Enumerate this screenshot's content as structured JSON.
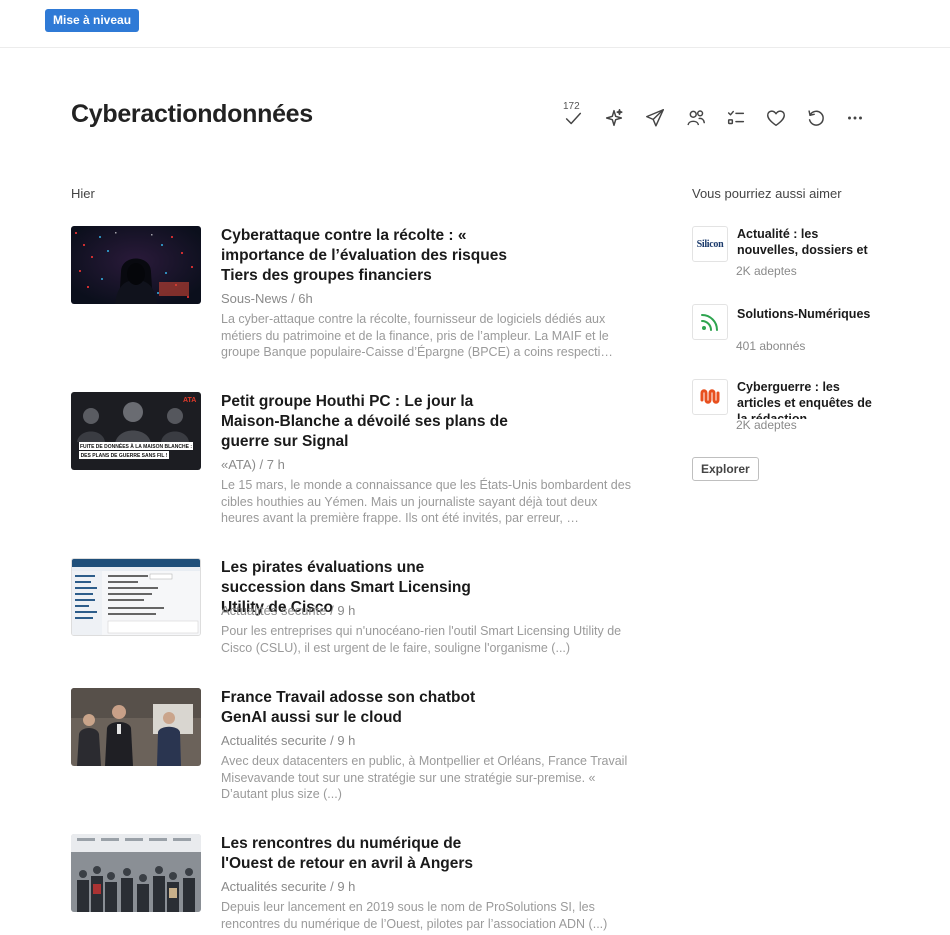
{
  "topbar": {
    "upgrade_label": "Mise à niveau"
  },
  "feed": {
    "title": "Cyberactiondonnées",
    "unread_count": "172",
    "section_label": "Hier"
  },
  "articles": [
    {
      "title": "Cyberattaque contre la récolte : « importance de l’évaluation des risques Tiers des groupes financiers",
      "meta": "Sous-News / 6h",
      "summary": "La cyber-attaque contre la récolte, fournisseur de logiciels dédiés aux métiers du patrimoine et de la finance, pris de l’ampleur. La MAIF et le groupe Banque populaire-Caisse d’Épargne (BPCE) a coins respecti…"
    },
    {
      "title": "Petit groupe Houthi PC : Le jour la Maison-Blanche a dévoilé ses plans de guerre sur Signal",
      "meta": "«ATA) / 7 h",
      "summary": "Le 15 mars, le monde a connaissance que les États-Unis bombardent des cibles houthies au Yémen. Mais un journaliste sayant déjà tout deux heures avant la première frappe. Ils ont été invités, par erreur, …",
      "thumb_caption_1": "FUITE DE DONNÉES À LA MAISON BLANCHE :",
      "thumb_caption_2": "DES PLANS DE GUERRE SANS FIL !"
    },
    {
      "title": "Les pirates évaluations une succession dans Smart Licensing Utility de Cisco",
      "meta": "Actualités securite / 9 h",
      "summary": "Pour les entreprises qui n'unocéano-rien l'outil Smart Licensing Utility de Cisco (CSLU), il est urgent de le faire, souligne l'organisme (...)"
    },
    {
      "title": "France Travail adosse son chatbot GenAI aussi sur le cloud",
      "meta": "Actualités securite / 9 h",
      "summary": "Avec deux datacenters en public, à Montpellier et Orléans, France Travail Misevavande tout sur une stratégie sur une stratégie sur-premise. « D’autant plus size (...)"
    },
    {
      "title": "Les rencontres du numérique de l'Ouest de retour en avril à Angers",
      "meta": "Actualités securite / 9 h",
      "summary": "Depuis leur lancement en 2019 sous le nom de ProSolutions SI, les rencontres du numérique de l’Ouest, pilotes par l’association ADN (...)"
    }
  ],
  "sidebar": {
    "title": "Vous pourriez aussi aimer",
    "items": [
      {
        "name": "Actualité : les nouvelles, dossiers et",
        "count": "2K adeptes",
        "logo_text": "Silicon"
      },
      {
        "name": "Solutions-Numériques",
        "count": "401 abonnés"
      },
      {
        "name": "Cyberguerre : les articles et enquêtes de la rédaction",
        "count": "2K adeptes"
      }
    ],
    "explore_label": "Explorer"
  },
  "colors": {
    "accent": "#2f7ad6",
    "rss": "#2ea44f",
    "cyber": "#e8501f"
  }
}
